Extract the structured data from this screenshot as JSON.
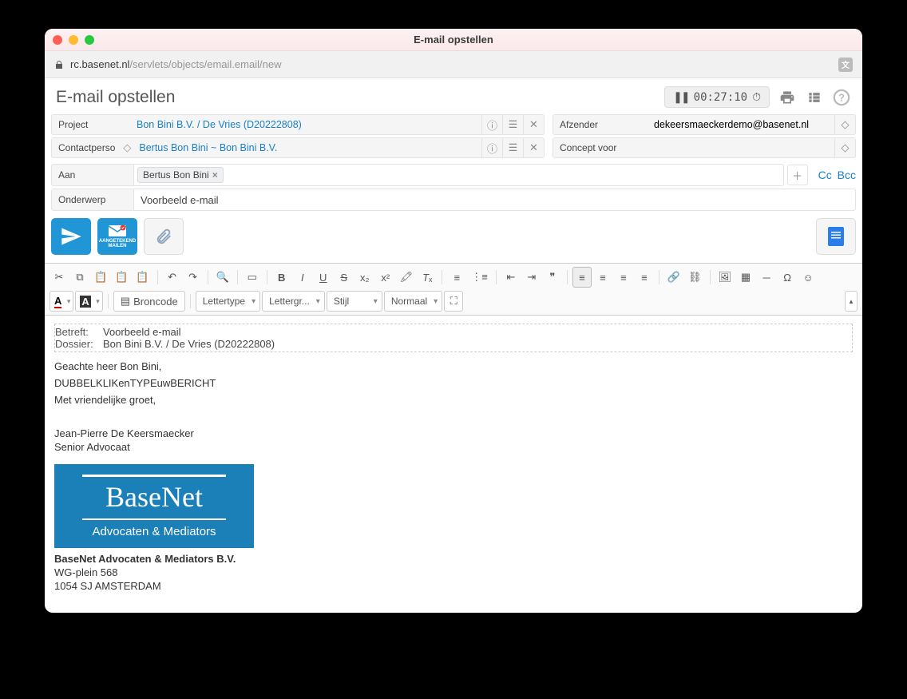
{
  "window": {
    "title": "E-mail opstellen"
  },
  "address": {
    "host": "rc.basenet.nl",
    "path": "/servlets/objects/email.email/new"
  },
  "page": {
    "title": "E-mail opstellen",
    "timer": "00:27:10"
  },
  "fields": {
    "project_label": "Project",
    "project_value": "Bon Bini B.V. / De Vries  (D20222808)",
    "contact_label": "Contactperso",
    "contact_value_a": "Bertus Bon Bini",
    "contact_sep": "~",
    "contact_value_b": "Bon Bini B.V.",
    "from_label": "Afzender",
    "from_value": "dekeersmaeckerdemo@basenet.nl",
    "draft_label": "Concept voor",
    "draft_value": ""
  },
  "to": {
    "label": "Aan",
    "chip": "Bertus Bon Bini",
    "cc": "Cc",
    "bcc": "Bcc"
  },
  "subject": {
    "label": "Onderwerp",
    "value": "Voorbeeld e-mail"
  },
  "registered_mail": {
    "line1": "AANGETEKEND",
    "line2": "MAILEN"
  },
  "toolbar": {
    "source": "Broncode",
    "font": "Lettertype",
    "size": "Lettergr...",
    "style": "Stijl",
    "format": "Normaal"
  },
  "body": {
    "meta_subject_k": "Betreft:",
    "meta_subject_v": "Voorbeeld e-mail",
    "meta_dossier_k": "Dossier:",
    "meta_dossier_v": "Bon Bini B.V. / De Vries (D20222808)",
    "greeting": "Geachte heer Bon Bini,",
    "placeholder": "DUBBELKLIKenTYPEuwBERICHT",
    "closing": "Met vriendelijke groet,",
    "name": "Jean-Pierre De Keersmaecker",
    "role": "Senior Advocaat",
    "logo_brand": "BaseNet",
    "logo_tag": "Advocaten & Mediators",
    "company": "BaseNet Advocaten & Mediators B.V.",
    "addr1": "WG-plein 568",
    "addr2": "1054 SJ AMSTERDAM"
  }
}
